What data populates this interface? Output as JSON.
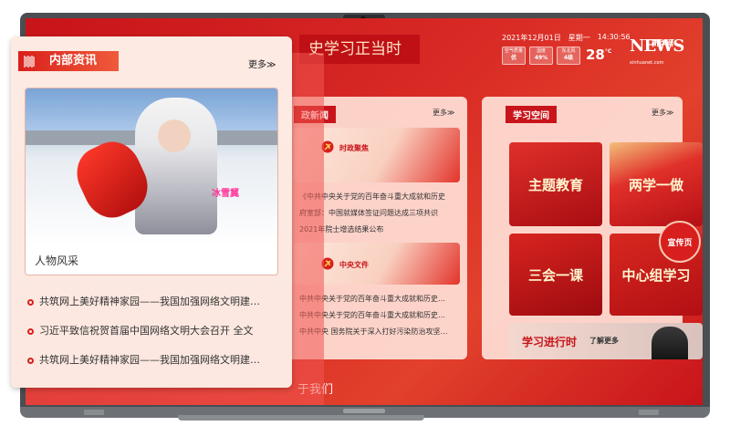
{
  "banner": {
    "title": "史学习正当时"
  },
  "header": {
    "date": "2021年12月01日",
    "weekday": "星期一",
    "time": "14:30:56",
    "air_label": "空气质量",
    "air_value": "优",
    "humidity_label": "湿度",
    "humidity_value": "49%",
    "wind_label": "东北风",
    "wind_value": "4级",
    "temperature": "28",
    "temperature_unit": "°C",
    "logo_letters": "NEWS",
    "logo_cn": "新华网",
    "logo_sub": "xinhuanet.com"
  },
  "left_panel": {
    "title": "内部资讯",
    "more": "更多≫",
    "photo_caption": "人物风采",
    "photo_tag": "冰雪冀",
    "items": [
      "共筑网上美好精神家园——我国加强网络文明建…",
      "习近平致信祝贺首届中国网络文明大会召开 全文",
      "共筑网上美好精神家园——我国加强网络文明建…"
    ]
  },
  "politics_panel": {
    "title": "政新闻",
    "more": "更多≫",
    "card1_caption": "时政聚焦",
    "card1_items": [
      "《中共中央关于党的百年奋斗重大成就和历史",
      "府室部：中国就媒体签证问题达成三项共识",
      "2021年院士增选结果公布"
    ],
    "card2_caption": "中央文件",
    "card2_items": [
      "中共中央关于党的百年奋斗重大成就和历史…",
      "中共中央关于党的百年奋斗重大成就和历史…",
      "中共中央 国务院关于深入打好污染防治攻坚…"
    ]
  },
  "study_panel": {
    "title": "学习空间",
    "more": "更多≫",
    "tiles": [
      "主题教育",
      "两学一做",
      "三会一课",
      "中心组学习"
    ],
    "banner_left": "学习进行时",
    "banner_right": "了解更多"
  },
  "fab": {
    "label": "宣传页"
  },
  "footer": {
    "label": "于我们"
  },
  "colors": {
    "brand_red": "#c8141a",
    "accent_red": "#d81f1d"
  }
}
